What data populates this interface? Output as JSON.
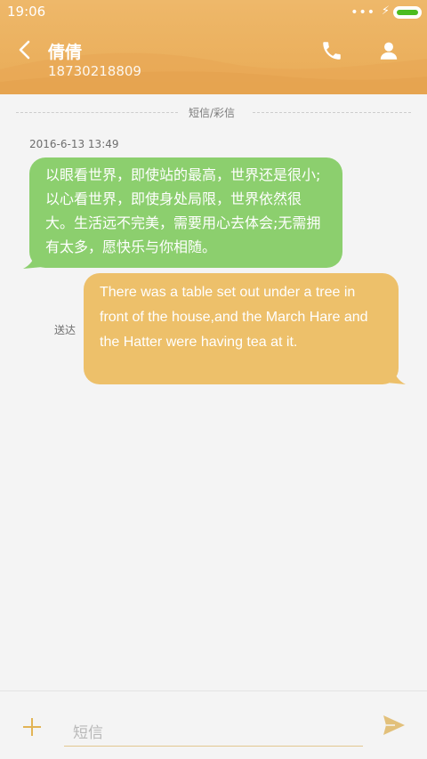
{
  "status_bar": {
    "time": "19:06",
    "signal_dots": "•••"
  },
  "header": {
    "contact_name": "倩倩",
    "contact_number": "18730218809",
    "icons": {
      "back": "back-arrow-icon",
      "call": "phone-icon",
      "contact": "person-icon"
    }
  },
  "thread": {
    "divider_label": "短信/彩信",
    "timestamp": "2016-6-13 13:49",
    "messages": [
      {
        "direction": "incoming",
        "text": "以眼看世界，即使站的最高，世界还是很小;以心看世界，即使身处局限，世界依然很大。生活远不完美，需要用心去体会;无需拥有太多，愿快乐与你相随。"
      },
      {
        "direction": "outgoing",
        "status": "送达",
        "text": "There was a table set out under a tree in front of the house,and the March Hare and the Hatter were having tea at it."
      }
    ]
  },
  "composer": {
    "placeholder": "短信",
    "icons": {
      "attach": "plus-icon",
      "send": "send-icon"
    }
  },
  "colors": {
    "header": "#eeb86a",
    "incoming_bubble": "#8ccf6e",
    "outgoing_bubble": "#edc06a",
    "accent": "#e2b455",
    "battery": "#4cbc1f"
  }
}
